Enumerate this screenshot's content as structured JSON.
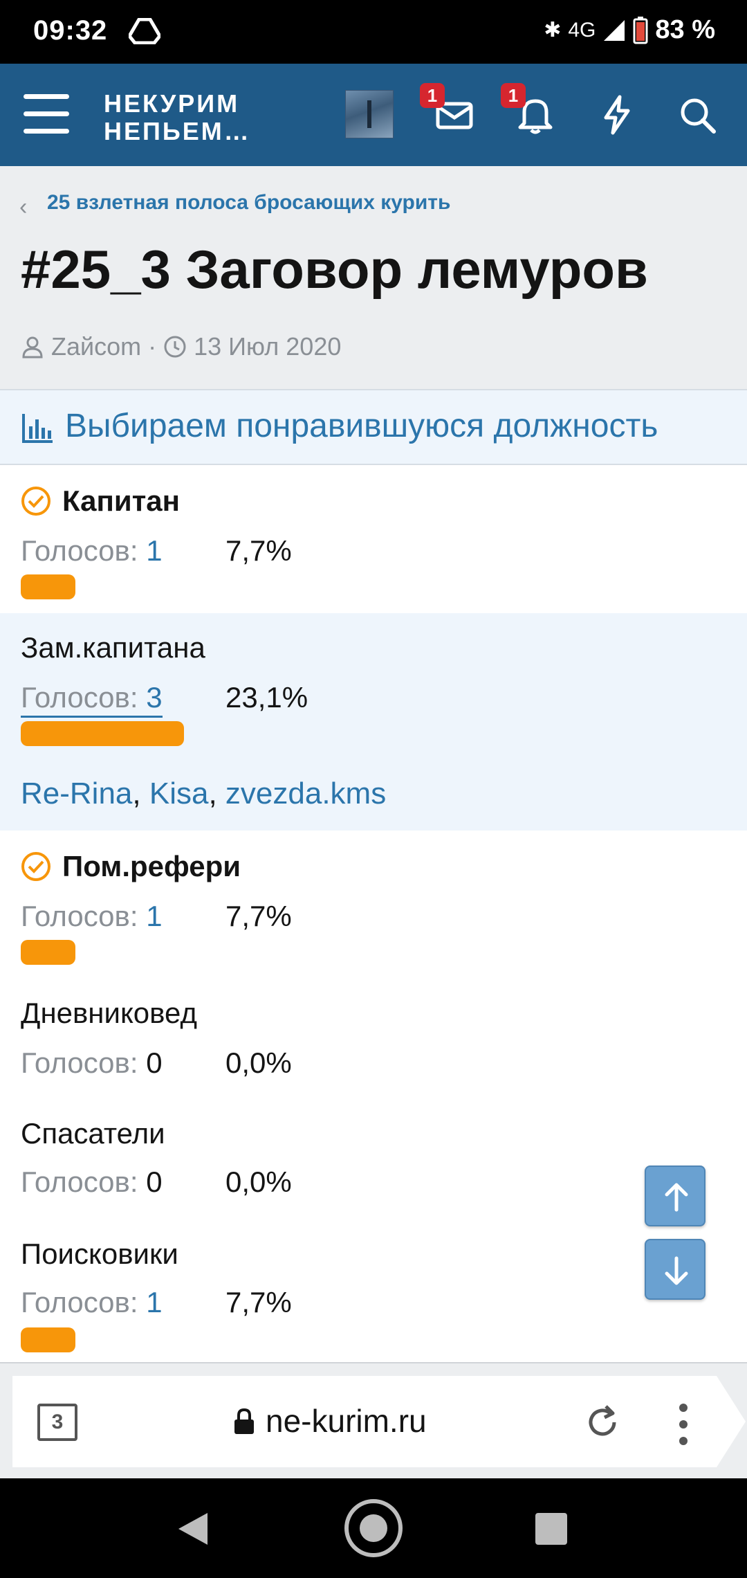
{
  "status_bar": {
    "time": "09:32",
    "network": "4G",
    "battery": "83 %"
  },
  "header": {
    "logo_line1": "НЕКУРИМ",
    "logo_line2": "НЕПЬЕМ…",
    "messages_badge": "1",
    "alerts_badge": "1"
  },
  "page": {
    "breadcrumb": "25 взлетная полоса бросающих курить",
    "title": "#25_3 Заговор лемуров",
    "author": "Zайсom",
    "meta_sep": "·",
    "date": "13 Июл 2020"
  },
  "poll": {
    "question": "Выбираем понравившуюся должность",
    "votes_label": "Голосов:",
    "options": [
      {
        "title": "Капитан",
        "voted_by_me": true,
        "votes": "1",
        "percent": "7,7%",
        "fraction": 0.077,
        "voters": []
      },
      {
        "title": "Зам.капитана",
        "voted_by_me": false,
        "votes": "3",
        "percent": "23,1%",
        "fraction": 0.231,
        "voters": [
          "Re-Rina",
          "Kisa",
          "zvezda.kms"
        ],
        "voter_sep": ","
      },
      {
        "title": "Пом.рефери",
        "voted_by_me": true,
        "votes": "1",
        "percent": "7,7%",
        "fraction": 0.077,
        "voters": []
      },
      {
        "title": "Дневниковед",
        "voted_by_me": false,
        "votes": "0",
        "percent": "0,0%",
        "fraction": 0,
        "voters": []
      },
      {
        "title": "Спасатели",
        "voted_by_me": false,
        "votes": "0",
        "percent": "0,0%",
        "fraction": 0,
        "voters": []
      },
      {
        "title": "Поисковики",
        "voted_by_me": false,
        "votes": "1",
        "percent": "7,7%",
        "fraction": 0.077,
        "voters": []
      }
    ],
    "bar_color": "#f7960a"
  },
  "browser": {
    "tabs_count": "3",
    "url": "ne-kurim.ru"
  },
  "colors": {
    "header_bg": "#1f5a88",
    "link": "#2b75ab",
    "accent": "#f7960a"
  }
}
